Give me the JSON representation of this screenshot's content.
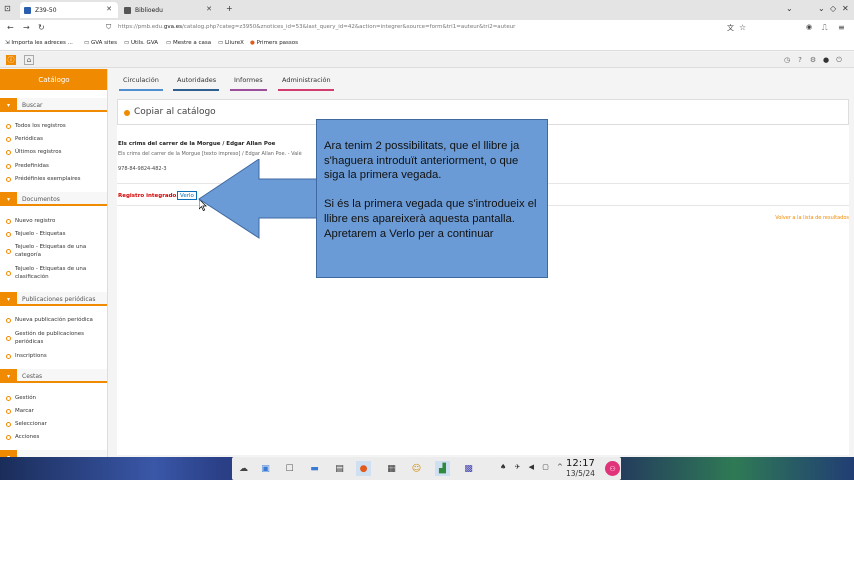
{
  "browser": {
    "tabs": [
      {
        "label": "Z39-50",
        "active": true
      },
      {
        "label": "Biblioedu",
        "active": false
      }
    ],
    "new_tab": "+",
    "url_prefix": "https://pmb.edu.",
    "url_domain": "gva.es",
    "url_rest": "/catalog.php?categ=z3950&znotices_id=53&last_query_id=42&action=integrer&source=form&tri1=auteur&tri2=auteur",
    "bookmarks": [
      "Importa les adreces ...",
      "GVA sites",
      "Utils. GVA",
      "Mestre a casa",
      "LliureX",
      "Primers passos"
    ]
  },
  "sidebar": {
    "header": "Catálogo",
    "sections": [
      {
        "label": "Buscar",
        "items": [
          "Todos los registros",
          "Periódicas",
          "Últimos registros",
          "Predefinidas",
          "Prédéfinies exemplaires"
        ]
      },
      {
        "label": "Documentos",
        "items": [
          "Nuevo registro",
          "Tejuelo - Etiquetas",
          "Tejuelo - Etiquetas de una categoría",
          "Tejuelo - Etiquetas de una clasificación"
        ]
      },
      {
        "label": "Publicaciones periódicas",
        "items": [
          "Nueva publicación periódica",
          "Gestión de publicaciones periódicas",
          "Inscriptions"
        ]
      },
      {
        "label": "Cestas",
        "items": [
          "Gestión",
          "Marcar",
          "Seleccionar",
          "Acciones"
        ]
      }
    ]
  },
  "topnav": {
    "tabs": [
      {
        "label": "Circulación",
        "color": "#4f8ecf"
      },
      {
        "label": "Autoridades",
        "color": "#2f5f8f"
      },
      {
        "label": "Informes",
        "color": "#9b4f9b"
      },
      {
        "label": "Administración",
        "color": "#d23c6e"
      }
    ]
  },
  "main": {
    "heading": "Copiar al catálogo",
    "record_title": "Els crims del carrer de la Morgue / Edgar Allan Poe",
    "record_detail": "Els crims del carrer de la Morgue [texto impreso] / Edgar Allan Poe. - Valè",
    "isbn": "978-84-9824-482-3",
    "status": "Registro integrado.",
    "verlo": "Verlo",
    "back_link": "Volver a la lista de resultados"
  },
  "annotation": {
    "paragraph1": "Ara tenim 2 possibilitats, que el llibre ja s'haguera introduït anteriorment, o que siga la primera vegada.",
    "paragraph2": "Si és la primera vegada que s'introdueix el llibre ens apareixerà aquesta pantalla. Apretarem a Verlo per a continuar"
  },
  "taskbar": {
    "time": "12:17",
    "date": "13/5/24"
  },
  "colors": {
    "accent": "#f08a00",
    "annotation_fill": "#6b9bd6",
    "status_red": "#d40000"
  }
}
